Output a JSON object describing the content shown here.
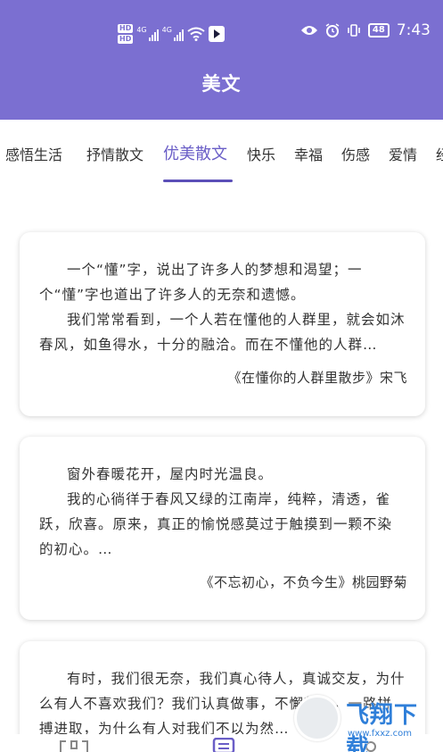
{
  "status": {
    "left_badges": [
      "HD",
      "HD"
    ],
    "signal_a": "4G",
    "signal_b": "4G",
    "battery": "48",
    "time": "7:43"
  },
  "header": {
    "title": "美文"
  },
  "tabs": [
    {
      "label": "感悟生活"
    },
    {
      "label": "抒情散文"
    },
    {
      "label": "优美散文"
    },
    {
      "label": "快乐"
    },
    {
      "label": "幸福"
    },
    {
      "label": "伤感"
    },
    {
      "label": "爱情"
    },
    {
      "label": "经"
    }
  ],
  "active_tab_index": 2,
  "articles": [
    {
      "paragraphs": [
        "一个“懂”字，说出了许多人的梦想和渴望；一个“懂”字也道出了许多人的无奈和遗憾。",
        "我们常常看到，一个人若在懂他的人群里，就会如沐春风，如鱼得水，十分的融洽。而在不懂他的人群…"
      ],
      "source": "《在懂你的人群里散步》宋飞"
    },
    {
      "paragraphs": [
        "窗外春暖花开，屋内时光温良。",
        "我的心徜徉于春风又绿的江南岸，纯粹，清透，雀跃，欣喜。原来，真正的愉悦感莫过于触摸到一颗不染的初心。…"
      ],
      "source": "《不忘初心，不负今生》桃园野菊"
    },
    {
      "paragraphs": [
        "有时，我们很无奈，我们真心待人，真诚交友，为什么有人不喜欢我们？我们认真做事，不懈努力，一路拼搏进取，为什么有人对我们不以为然…"
      ],
      "source": ""
    }
  ],
  "watermark": {
    "text": "飞翔下载",
    "url": "www.fxxz.com"
  },
  "colors": {
    "header": "#7b6fd1",
    "active_tab": "#6a5ec7"
  }
}
